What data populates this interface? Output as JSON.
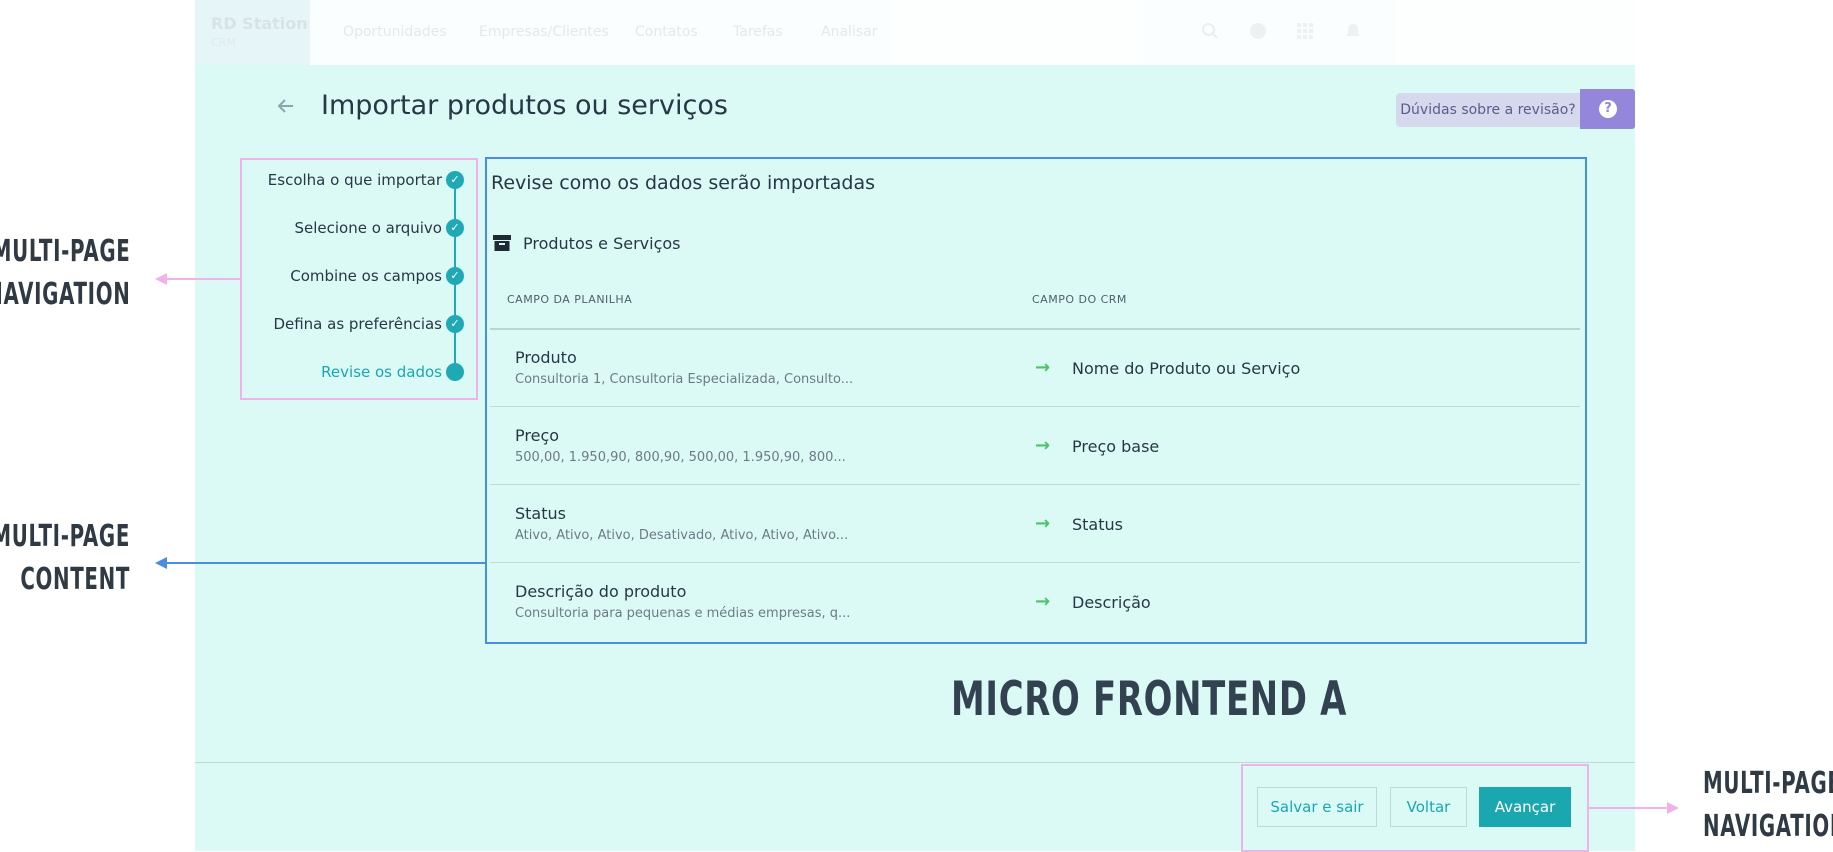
{
  "topbar": {
    "brand_name": "RD Station",
    "brand_sub": "CRM",
    "nav": [
      "Oportunidades",
      "Empresas/Clientes",
      "Contatos",
      "Tarefas",
      "Analisar"
    ],
    "icons": [
      "search-icon",
      "help-circle-icon",
      "apps-grid-icon",
      "bell-icon"
    ]
  },
  "page": {
    "title": "Importar produtos ou serviços",
    "help_label": "Dúvidas sobre a revisão?",
    "help_icon": "?"
  },
  "steps": [
    {
      "label": "Escolha o que importar",
      "state": "done"
    },
    {
      "label": "Selecione o arquivo",
      "state": "done"
    },
    {
      "label": "Combine os campos",
      "state": "done"
    },
    {
      "label": "Defina as preferências",
      "state": "done"
    },
    {
      "label": "Revise os dados",
      "state": "current"
    }
  ],
  "review": {
    "title": "Revise como os dados serão importadas",
    "entity_label": "Produtos e Serviços",
    "col_sheet": "CAMPO DA PLANILHA",
    "col_crm": "CAMPO DO CRM",
    "rows": [
      {
        "name": "Produto",
        "sample": "Consultoria 1, Consultoria Especializada, Consulto...",
        "crm_field": "Nome do Produto ou Serviço"
      },
      {
        "name": "Preço",
        "sample": "500,00, 1.950,90, 800,90, 500,00, 1.950,90, 800...",
        "crm_field": "Preço base"
      },
      {
        "name": "Status",
        "sample": "Ativo, Ativo, Ativo, Desativado, Ativo, Ativo, Ativo...",
        "crm_field": "Status"
      },
      {
        "name": "Descrição do produto",
        "sample": "Consultoria para pequenas e médias empresas, q...",
        "crm_field": "Descrição"
      }
    ]
  },
  "footer": {
    "save_exit": "Salvar e sair",
    "back": "Voltar",
    "next": "Avançar"
  },
  "annotations": {
    "micro_frontend": "MICRO FRONTEND A",
    "nav_left_1": "MULTI-PAGE",
    "nav_left_2": "NAVIGATION",
    "content_left_1": "MULTI-PAGE",
    "content_left_2": "CONTENT",
    "nav_right_1": "MULTI-PAGE",
    "nav_right_2": "NAVIGATION"
  },
  "colors": {
    "app_bg": "#dcfaf5",
    "accent": "#1aa7b0",
    "check_arrow": "#4cc36a",
    "annotation_pink": "#eeb3e8",
    "annotation_blue": "#4a8ee0",
    "help_purple": "#9486db"
  }
}
